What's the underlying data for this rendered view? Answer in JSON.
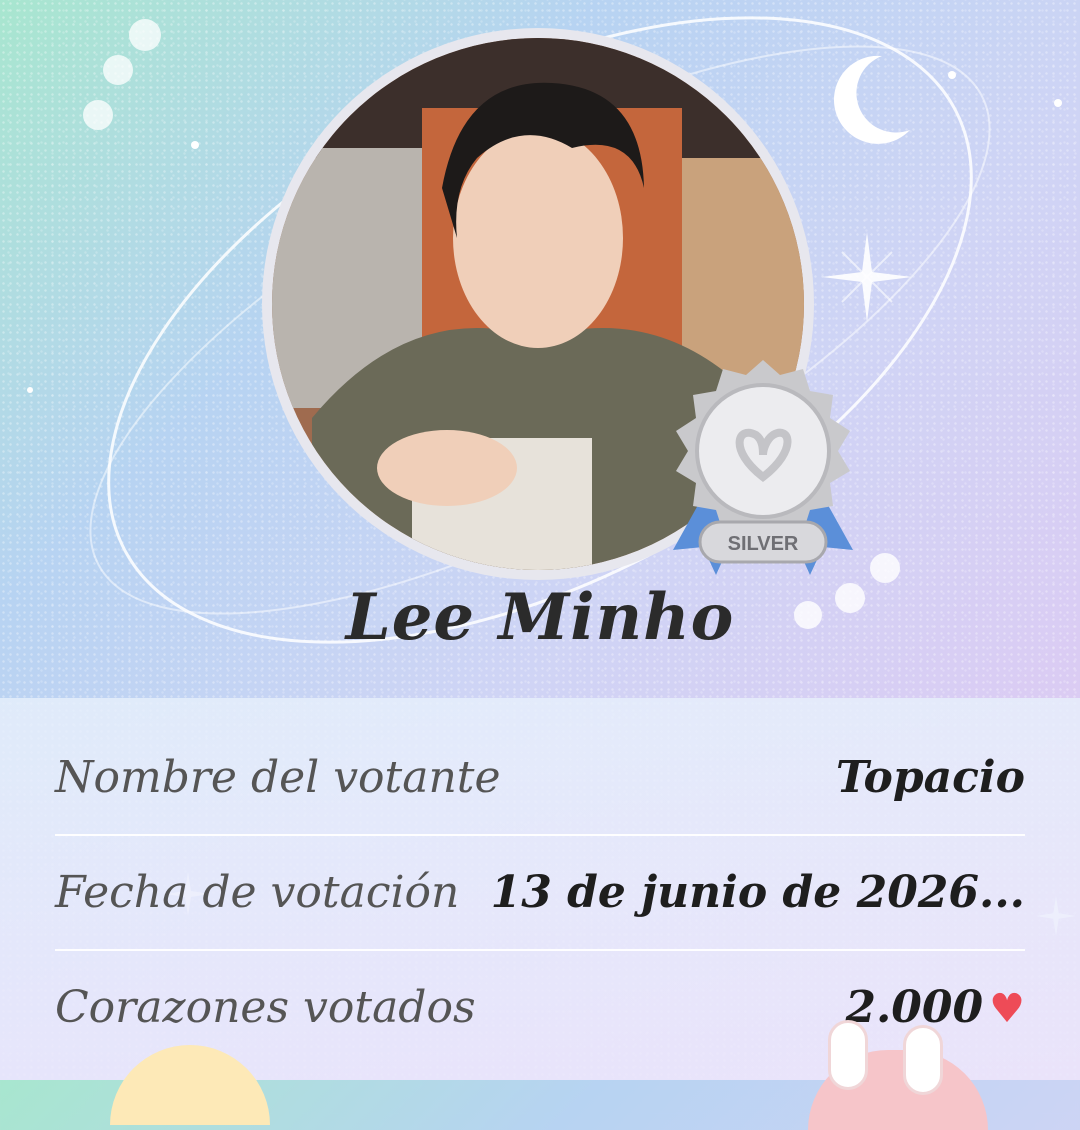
{
  "idol": {
    "name": "Lee Minho",
    "badge_label": "SILVER",
    "portrait_icon": "person-portrait"
  },
  "vote_details": {
    "rows": [
      {
        "label": "Nombre del votante",
        "value": "Topacio"
      },
      {
        "label": "Fecha de votación",
        "value": "13 de junio de 2026..."
      },
      {
        "label": "Corazones votados",
        "value": "2.000",
        "icon": "heart-icon"
      }
    ]
  },
  "colors": {
    "heart": "#ee4b57",
    "medal_silver": "#c9c9cc",
    "ribbon_blue": "#5b8fd9",
    "bg_start": "#a8e6cf",
    "bg_end": "#e3c6f2"
  }
}
